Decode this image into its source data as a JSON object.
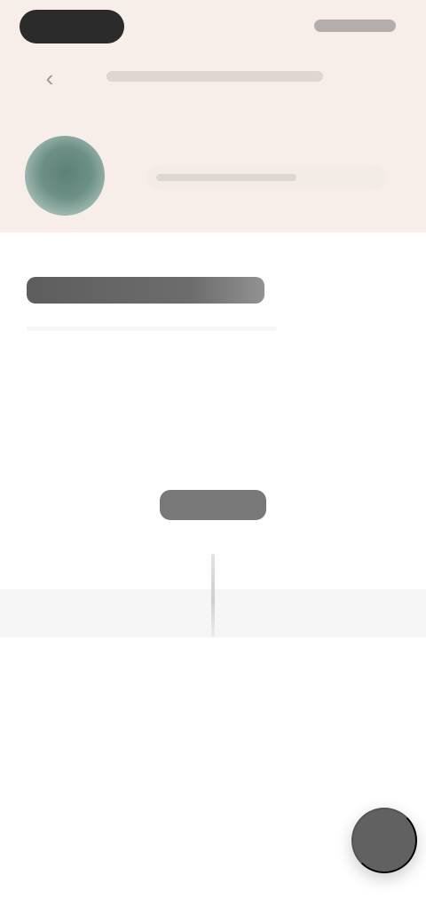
{
  "header": {
    "background_color": "#f7eee9",
    "back_icon": "back-arrow-icon",
    "caption": "",
    "avatar_icon": "profile-avatar-icon",
    "profile_text": ""
  },
  "status_bar": {
    "pill_color": "#2b2b2b",
    "icons_name": "status-icons"
  },
  "content": {
    "section_heading": "",
    "center_label": "",
    "loading_indicator": "vertical-loading-line"
  },
  "fab": {
    "icon": "round-action-button",
    "color": "#616161"
  }
}
